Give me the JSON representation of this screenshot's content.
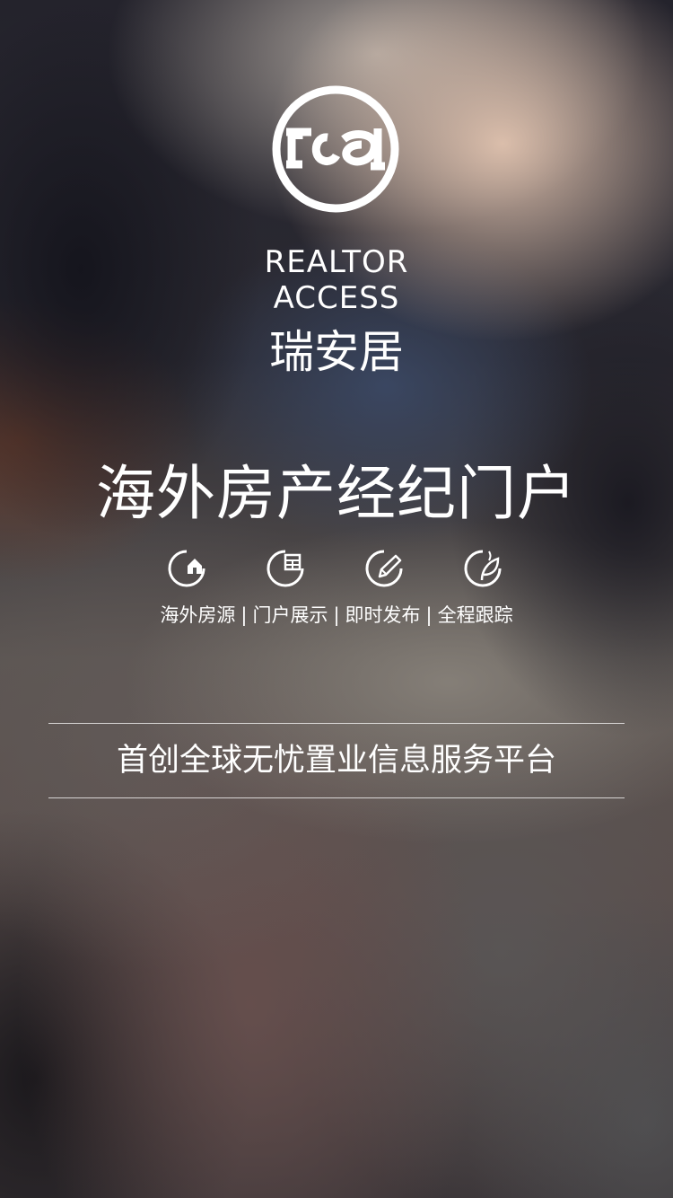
{
  "brand": {
    "logo_icon": "rca-ring-logo-icon",
    "name_en_line1": "REALTOR",
    "name_en_line2": "ACCESS",
    "name_cn": "瑞安居"
  },
  "headline": "海外房产经纪门户",
  "features": [
    {
      "label": "海外房源",
      "icon": "house-circle-icon"
    },
    {
      "label": "门户展示",
      "icon": "window-circle-icon"
    },
    {
      "label": "即时发布",
      "icon": "pencil-circle-icon"
    },
    {
      "label": "全程跟踪",
      "icon": "leaf-circle-icon"
    }
  ],
  "separator": "|",
  "tagline": "首创全球无忧置业信息服务平台"
}
